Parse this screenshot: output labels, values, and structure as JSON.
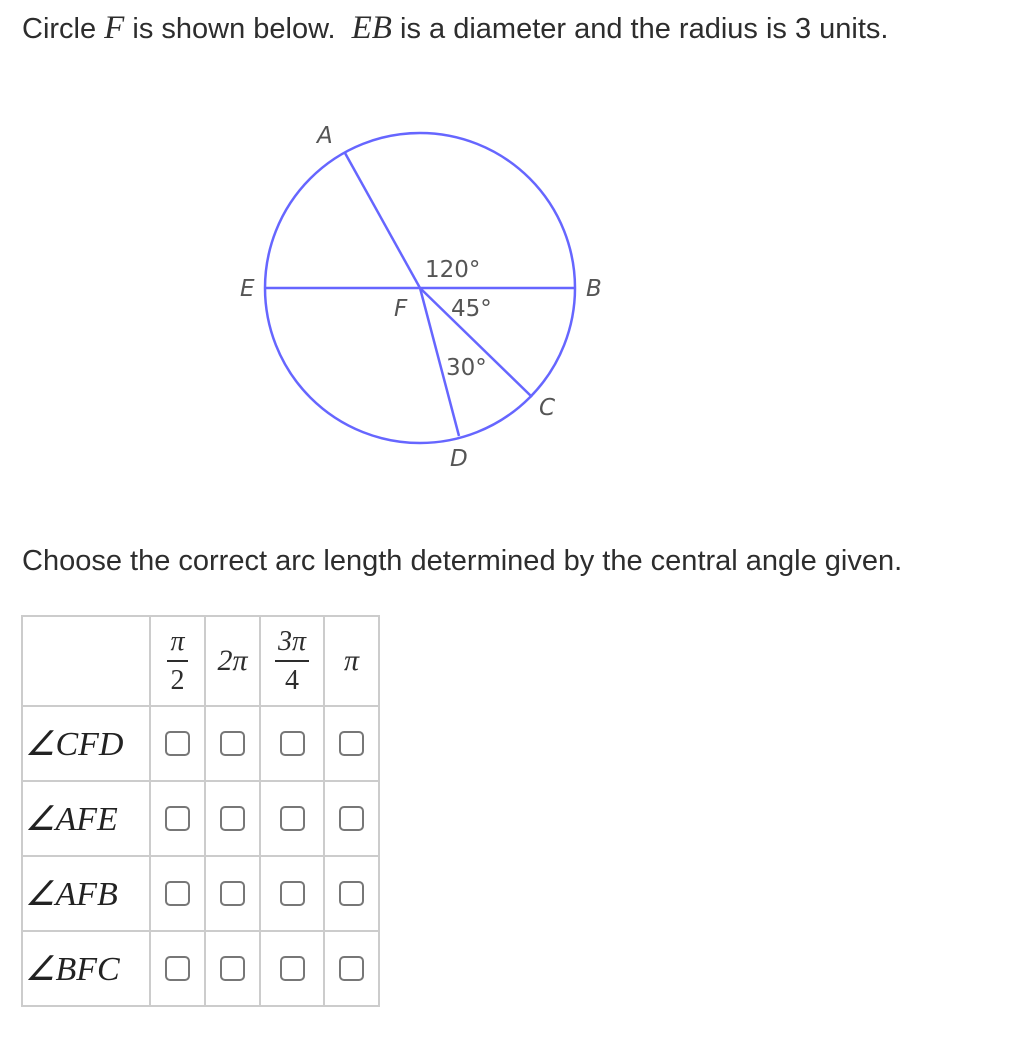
{
  "prompt": {
    "prefix": "Circle ",
    "circle_name": "F",
    "middle": " is shown below. ",
    "diameter_name": "EB",
    "suffix": " is a diameter and the radius is 3 units."
  },
  "figure": {
    "stroke_color": "#6666ff",
    "points": {
      "A": "A",
      "B": "B",
      "C": "C",
      "D": "D",
      "E": "E",
      "F": "F"
    },
    "angles": {
      "AFB": "120°",
      "BFC": "45°",
      "CFD": "30°"
    }
  },
  "instruction": "Choose the correct arc length determined by the central angle given.",
  "table": {
    "columns": [
      {
        "type": "fraction",
        "numerator": "π",
        "denominator": "2"
      },
      {
        "type": "plain",
        "text": "2π"
      },
      {
        "type": "fraction",
        "numerator": "3π",
        "denominator": "4"
      },
      {
        "type": "plain",
        "text": "π"
      }
    ],
    "rows": [
      {
        "label": "∠CFD",
        "checked": [
          false,
          false,
          false,
          false
        ]
      },
      {
        "label": "∠AFE",
        "checked": [
          false,
          false,
          false,
          false
        ]
      },
      {
        "label": "∠AFB",
        "checked": [
          false,
          false,
          false,
          false
        ]
      },
      {
        "label": "∠BFC",
        "checked": [
          false,
          false,
          false,
          false
        ]
      }
    ]
  }
}
